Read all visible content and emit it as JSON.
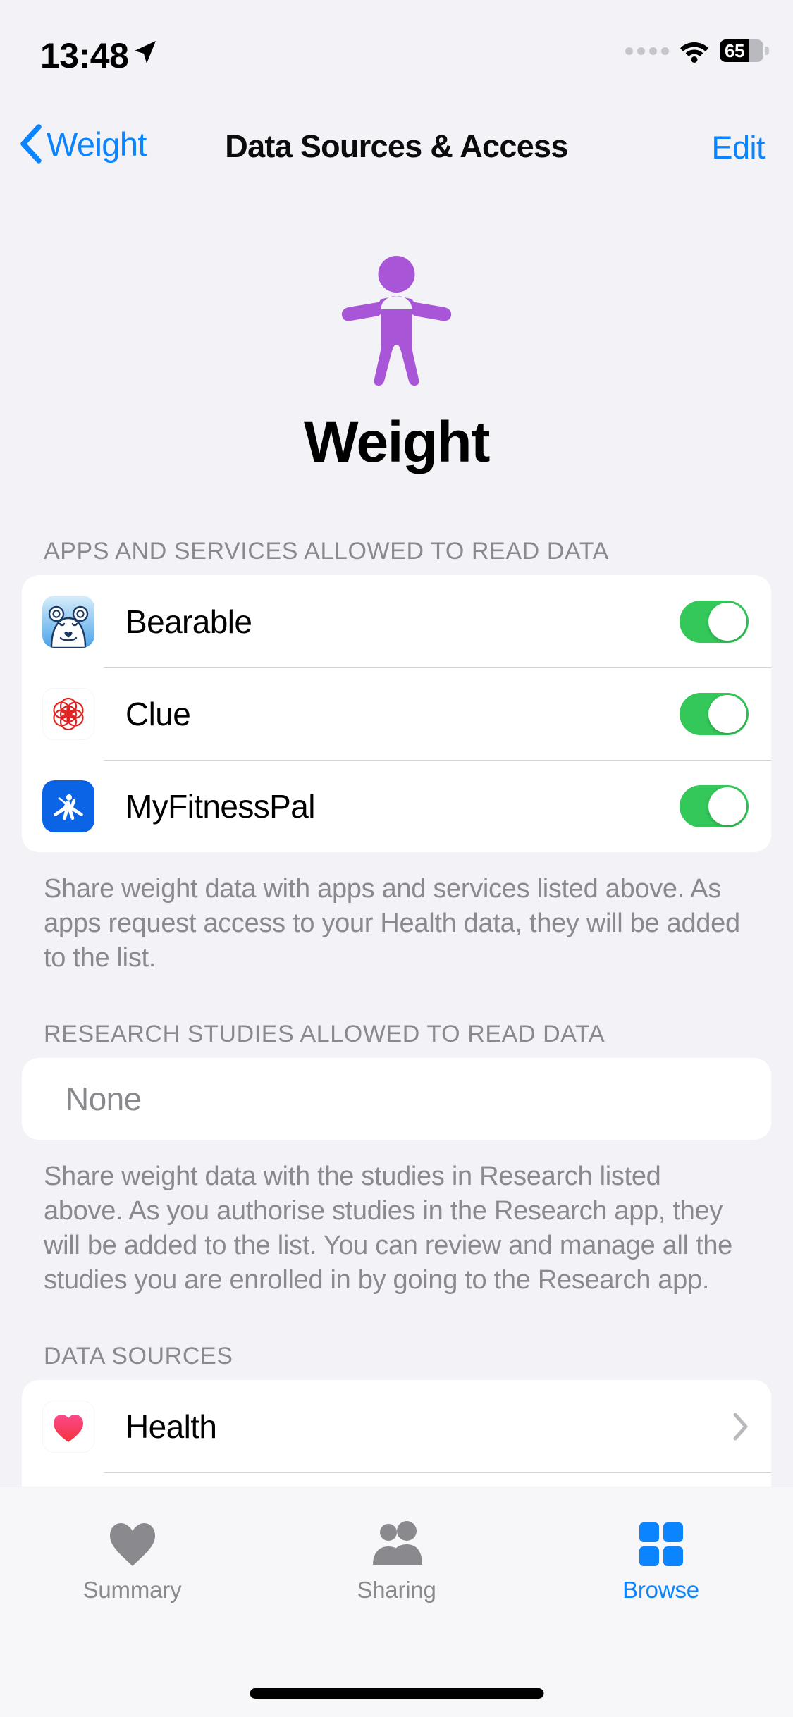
{
  "status_bar": {
    "time": "13:48",
    "location_icon": "location-arrow-icon",
    "cellular_icon": "cellular-dots-icon",
    "wifi_icon": "wifi-icon",
    "battery_percent": "65"
  },
  "nav": {
    "back_icon": "chevron-left-icon",
    "back_label": "Weight",
    "title": "Data Sources & Access",
    "edit_label": "Edit"
  },
  "hero": {
    "icon": "body-figure-icon",
    "icon_color": "#a855d8",
    "title": "Weight"
  },
  "sections": [
    {
      "header": "APPS AND SERVICES ALLOWED TO READ DATA",
      "rows": [
        {
          "icon": "bearable-app-icon",
          "label": "Bearable",
          "toggle": "on"
        },
        {
          "icon": "clue-app-icon",
          "label": "Clue",
          "toggle": "on"
        },
        {
          "icon": "myfitnesspal-app-icon",
          "label": "MyFitnessPal",
          "toggle": "on"
        }
      ],
      "footnote": "Share weight data with apps and services listed above. As apps request access to your Health data, they will be added to the list."
    },
    {
      "header": "RESEARCH STUDIES ALLOWED TO READ DATA",
      "empty_label": "None",
      "footnote": "Share weight data with the studies in Research listed above. As you authorise studies in the Research app, they will be added to the list. You can review and manage all the studies you are enrolled in by going to the Research app."
    },
    {
      "header": "DATA SOURCES",
      "rows": [
        {
          "icon": "health-app-icon",
          "label": "Health",
          "accessory": "chevron-right-icon"
        }
      ]
    }
  ],
  "tabbar": {
    "items": [
      {
        "icon": "heart-icon",
        "label": "Summary",
        "active": false
      },
      {
        "icon": "people-icon",
        "label": "Sharing",
        "active": false
      },
      {
        "icon": "grid-squares-icon",
        "label": "Browse",
        "active": true
      }
    ],
    "active_color": "#0a84ff",
    "inactive_color": "#8a8a8e"
  },
  "colors": {
    "background": "#f2f2f7",
    "card": "#ffffff",
    "accent_blue": "#0a84ff",
    "toggle_on": "#34c759",
    "secondary_text": "#8a8a8e"
  }
}
